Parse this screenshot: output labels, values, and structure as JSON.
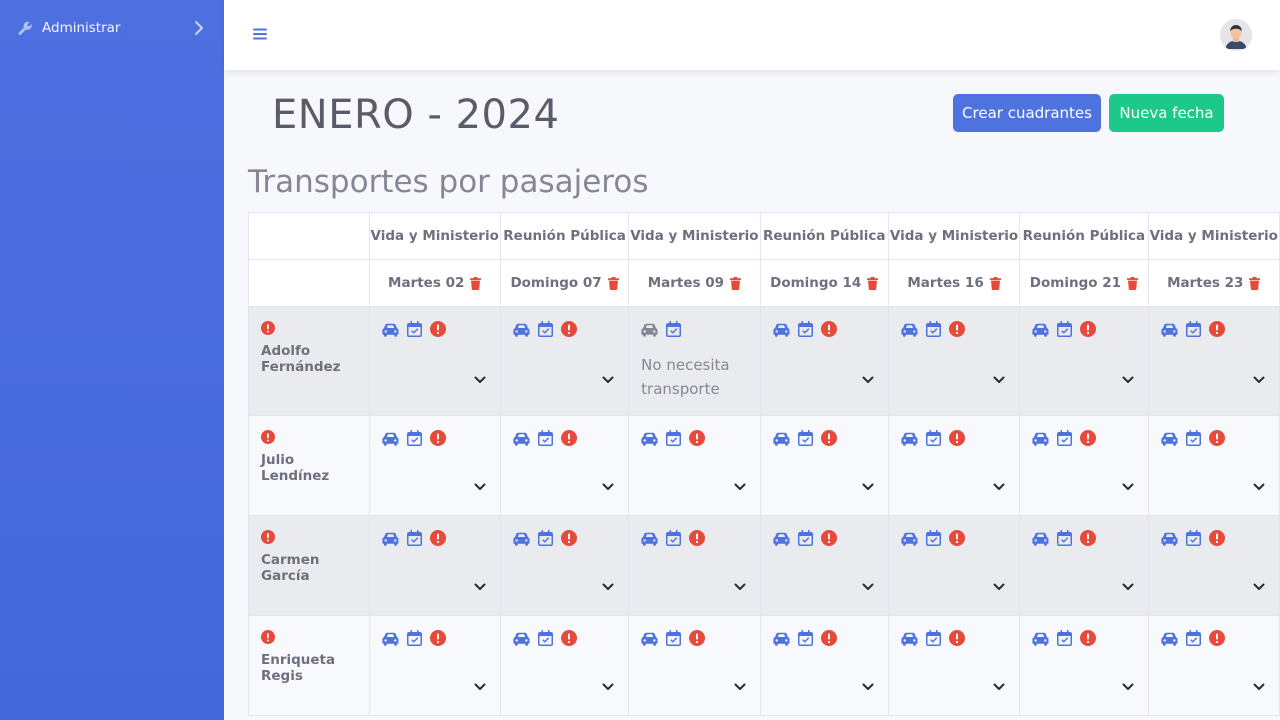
{
  "sidebar": {
    "items": [
      {
        "label": "Administrar",
        "icon": "wrench-icon"
      }
    ]
  },
  "header": {
    "menu_icon": "hamburger-icon",
    "avatar_icon": "user-avatar"
  },
  "page": {
    "title": "ENERO - 2024",
    "buttons": {
      "create": "Crear cuadrantes",
      "new_date": "Nueva fecha"
    },
    "section_title": "Transportes por pasajeros"
  },
  "table": {
    "meetings": [
      "Vida y Ministerio",
      "Reunión Pública",
      "Vida y Ministerio",
      "Reunión Pública",
      "Vida y Ministerio",
      "Reunión Pública",
      "Vida y Ministerio"
    ],
    "dates": [
      "Martes 02",
      "Domingo 07",
      "Martes 09",
      "Domingo 14",
      "Martes 16",
      "Domingo 21",
      "Martes 23"
    ],
    "rows": [
      {
        "name": "Adolfo Fernández",
        "cells": [
          "select",
          "select",
          "none",
          "select",
          "select",
          "select",
          "select"
        ]
      },
      {
        "name": "Julio Lendínez",
        "cells": [
          "select",
          "select",
          "select",
          "select",
          "select",
          "select",
          "select"
        ]
      },
      {
        "name": "Carmen García",
        "cells": [
          "select",
          "select",
          "select",
          "select",
          "select",
          "select",
          "select"
        ]
      },
      {
        "name": "Enriqueta Regis",
        "cells": [
          "select",
          "select",
          "select",
          "select",
          "select",
          "select",
          "select"
        ]
      }
    ],
    "no_transport_label": "No necesita transporte"
  },
  "colors": {
    "sidebar": "#4e73df",
    "primary": "#4e73df",
    "success": "#1cc88a",
    "danger": "#e74a3b",
    "muted_icon": "#858796"
  }
}
